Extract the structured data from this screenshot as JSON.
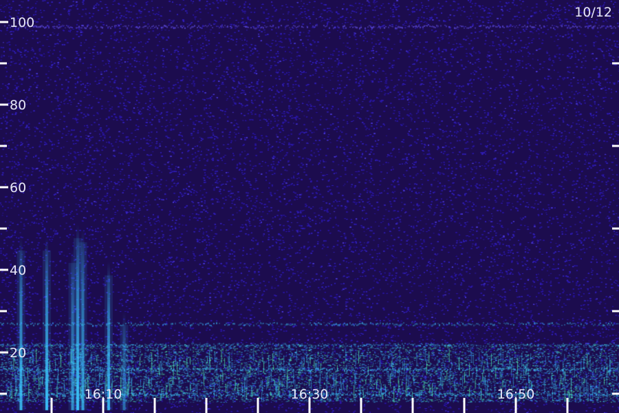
{
  "chart_data": {
    "type": "heatmap",
    "title": "",
    "date_label": "10/12",
    "xlabel": "",
    "ylabel": "",
    "y_ticks": [
      {
        "value": 20,
        "label": "20"
      },
      {
        "value": 40,
        "label": "40"
      },
      {
        "value": 60,
        "label": "60"
      },
      {
        "value": 80,
        "label": "80"
      },
      {
        "value": 100,
        "label": "100"
      }
    ],
    "y_minor_ticks": [
      10,
      30,
      50,
      70,
      90
    ],
    "ylim": [
      0,
      105
    ],
    "x_labels": [
      {
        "minute": 10,
        "label": "16:10"
      },
      {
        "minute": 30,
        "label": "16:30"
      },
      {
        "minute": 50,
        "label": "16:50"
      }
    ],
    "x_ticks_minutes": [
      5,
      10,
      15,
      20,
      25,
      30,
      35,
      40,
      45,
      50,
      55
    ],
    "xlim_minutes": [
      0,
      60
    ],
    "background_color": "#1c0c4e",
    "noise_color": "#2a17a0",
    "emission_bands": [
      {
        "y": 27,
        "intensity": 0.6
      },
      {
        "y": 22,
        "intensity": 0.5
      },
      {
        "y": 16,
        "intensity": 0.7
      },
      {
        "y": 10,
        "intensity": 0.7
      },
      {
        "y": 99,
        "intensity": 0.3
      }
    ],
    "bursts": [
      {
        "minute": 2,
        "top": 48,
        "intensity": 0.9
      },
      {
        "minute": 4.5,
        "top": 48,
        "intensity": 1.0
      },
      {
        "minute": 7,
        "top": 45,
        "intensity": 0.7
      },
      {
        "minute": 7.5,
        "top": 51,
        "intensity": 1.0
      },
      {
        "minute": 8,
        "top": 50,
        "intensity": 0.8
      },
      {
        "minute": 10.5,
        "top": 42,
        "intensity": 0.9
      },
      {
        "minute": 12,
        "top": 30,
        "intensity": 0.5
      }
    ]
  }
}
